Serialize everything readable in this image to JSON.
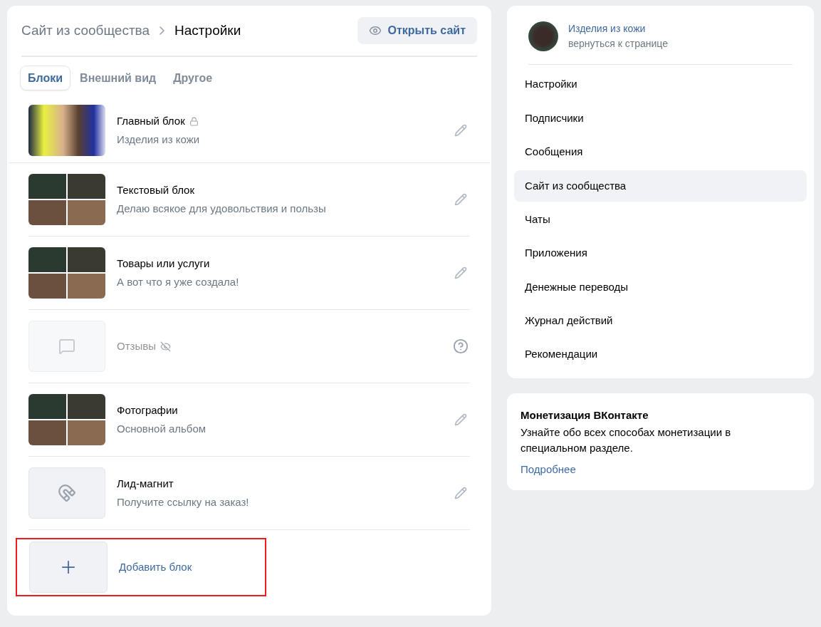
{
  "breadcrumb": {
    "parent": "Сайт из сообщества",
    "current": "Настройки"
  },
  "open_site_button": "Открыть сайт",
  "tabs": [
    {
      "label": "Блоки",
      "selected": true
    },
    {
      "label": "Внешний вид",
      "selected": false
    },
    {
      "label": "Другое",
      "selected": false
    }
  ],
  "blocks": [
    {
      "title": "Главный блок",
      "subtitle": "Изделия из кожи",
      "kind": "photo",
      "locked": true,
      "hidden": false
    },
    {
      "title": "Текстовый блок",
      "subtitle": "Делаю всякое для удовольствия и пользы",
      "kind": "collage",
      "locked": false,
      "hidden": false
    },
    {
      "title": "Товары или услуги",
      "subtitle": "А вот что я уже создала!",
      "kind": "collage",
      "locked": false,
      "hidden": false
    },
    {
      "title": "Отзывы",
      "kind": "comment",
      "locked": false,
      "hidden": true
    },
    {
      "title": "Фотографии",
      "subtitle": "Основной альбом",
      "kind": "collage",
      "locked": false,
      "hidden": false
    },
    {
      "title": "Лид-магнит",
      "subtitle": "Получите ссылку на заказ!",
      "kind": "magnet",
      "locked": false,
      "hidden": false
    }
  ],
  "add_block": {
    "label": "Добавить блок",
    "highlighted": true
  },
  "community": {
    "name": "Изделия из кожи",
    "back_link": "вернуться к странице"
  },
  "menu": [
    {
      "label": "Настройки",
      "selected": false
    },
    {
      "label": "Подписчики",
      "selected": false
    },
    {
      "label": "Сообщения",
      "selected": false
    },
    {
      "label": "Сайт из сообщества",
      "selected": true
    },
    {
      "label": "Чаты",
      "selected": false
    },
    {
      "label": "Приложения",
      "selected": false
    },
    {
      "label": "Денежные переводы",
      "selected": false
    },
    {
      "label": "Журнал действий",
      "selected": false
    },
    {
      "label": "Рекомендации",
      "selected": false
    }
  ],
  "promo": {
    "title": "Монетизация ВКонтакте",
    "text": "Узнайте обо всех способах монетизации в специальном разделе.",
    "link": "Подробнее"
  }
}
